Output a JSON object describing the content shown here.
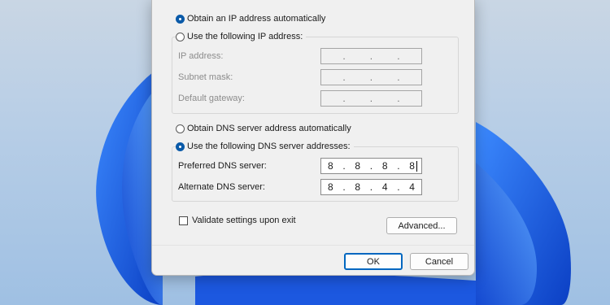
{
  "ip_section": {
    "auto_label": "Obtain an IP address automatically",
    "manual_label": "Use the following IP address:",
    "fields": [
      {
        "label": "IP address:",
        "value": ". . ."
      },
      {
        "label": "Subnet mask:",
        "value": ". . ."
      },
      {
        "label": "Default gateway:",
        "value": ". . ."
      }
    ],
    "selected": "auto"
  },
  "dns_section": {
    "auto_label": "Obtain DNS server address automatically",
    "manual_label": "Use the following DNS server addresses:",
    "selected": "manual",
    "preferred": {
      "label": "Preferred DNS server:",
      "octets": [
        "8",
        "8",
        "8",
        "8"
      ]
    },
    "alternate": {
      "label": "Alternate DNS server:",
      "octets": [
        "8",
        "8",
        "4",
        "4"
      ]
    }
  },
  "validate_label": "Validate settings upon exit",
  "validate_checked": false,
  "advanced_label": "Advanced...",
  "ok_label": "OK",
  "cancel_label": "Cancel",
  "colors": {
    "accent": "#0067c0",
    "wallpaper_blue": "#1a5fe0"
  }
}
